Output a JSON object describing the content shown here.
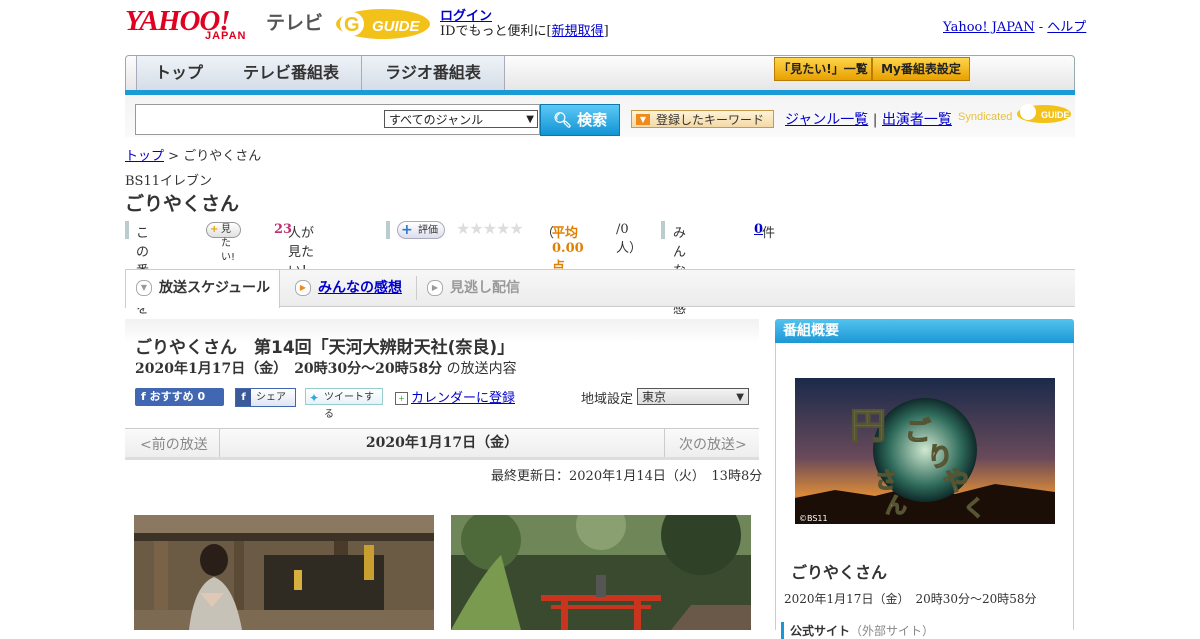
{
  "header": {
    "logo_text": "YAHOO!",
    "logo_sub": "JAPAN",
    "service": "テレビ",
    "gguide": "G GUIDE",
    "login": "ログイン",
    "id_prefix": "IDでもっと便利に[",
    "register": "新規取得",
    "id_suffix": "]",
    "yahoo_japan": "Yahoo! JAPAN",
    "sep": " - ",
    "help": "ヘルプ"
  },
  "nav": {
    "tabs": [
      "トップ",
      "テレビ番組表",
      "ラジオ番組表"
    ],
    "want_list": "「見たい!」一覧",
    "my_schedule": "My番組表設定"
  },
  "search": {
    "placeholder": "",
    "genre": "すべてのジャンル",
    "button": "検索",
    "keywords": "登録したキーワード",
    "genre_list": "ジャンル一覧",
    "divider": "|",
    "performers": "出演者一覧",
    "syndicated": "Syndicated"
  },
  "breadcrumb": {
    "top": "トップ",
    "sep": " > ",
    "current": "ごりやくさん"
  },
  "program": {
    "channel": "BS11イレブン",
    "title": "ごりやくさん",
    "this_program": "この番組を",
    "want_btn": "見たい!",
    "want_count": "23",
    "want_suffix": "人が見たい！",
    "rating_btn": "評価",
    "stars": "★★★★★",
    "avg_prefix": "（",
    "avg": "平均0.00点",
    "avg_suffix": "/0人）",
    "impressions_label": "みんなの感想",
    "impressions_count": "0",
    "impressions_suffix": "件"
  },
  "subtabs": [
    "放送スケジュール",
    "みんなの感想",
    "見逃し配信"
  ],
  "episode": {
    "title": "ごりやくさん　第14回「天河大辨財天社(奈良)」",
    "time": "2020年1月17日（金）　20時30分～20時58分",
    "time_suffix": " の放送内容",
    "fb_recommend": "おすすめ 0",
    "share": "シェア",
    "tweet": "ツイートする",
    "calendar": "カレンダーに登録",
    "region_label": "地域設定",
    "region_value": "東京"
  },
  "datenav": {
    "prev": "<前の放送",
    "current": "2020年1月17日（金）",
    "next": "次の放送>"
  },
  "updated": "最終更新日：2020年1月14日（火）　13時8分",
  "sidebar": {
    "heading": "番組概要",
    "image_copyright": "©BS11",
    "title": "ごりやくさん",
    "time": "2020年1月17日（金）　20時30分～20時58分",
    "official_site": "公式サイト",
    "external": "（外部サイト）"
  },
  "colors": {
    "accent_blue": "#1a9ad6",
    "yahoo_red": "#e00020",
    "link": "#0000cc",
    "want_count": "#c03070",
    "avg": "#e08000"
  }
}
